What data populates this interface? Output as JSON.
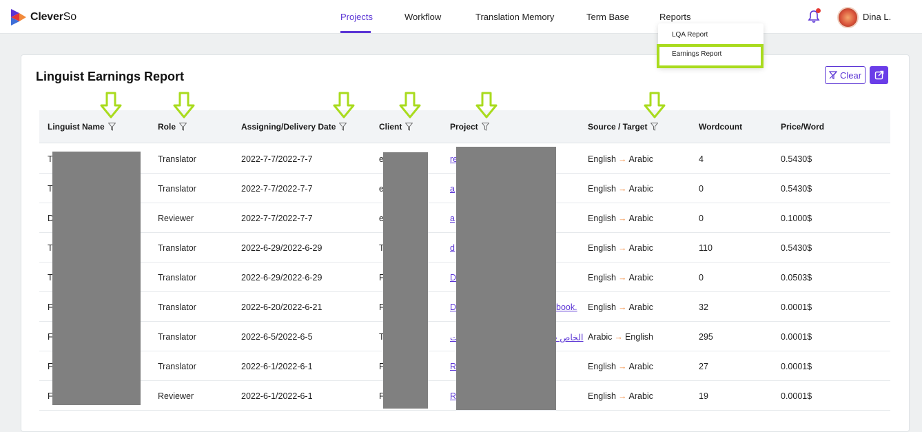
{
  "brand": {
    "name_bold": "Clever",
    "name_light": "So"
  },
  "nav": [
    {
      "label": "Projects",
      "active": true
    },
    {
      "label": "Workflow",
      "active": false
    },
    {
      "label": "Translation Memory",
      "active": false
    },
    {
      "label": "Term Base",
      "active": false
    },
    {
      "label": "Reports",
      "active": false
    }
  ],
  "reports_menu": [
    "LQA Report",
    "Earnings Report"
  ],
  "user": {
    "name": "Dina L."
  },
  "page": {
    "title": "Linguist Earnings Report",
    "clear_label": "Clear"
  },
  "table": {
    "headers": [
      "Linguist Name",
      "Role",
      "Assigning/Delivery Date",
      "Client",
      "Project",
      "Source / Target",
      "Wordcount",
      "Price/Word"
    ],
    "rows": [
      {
        "name": "T",
        "role": "Translator",
        "dates": "2022-7-7/2022-7-7",
        "client": "e",
        "project": "re",
        "project_tail": "",
        "source": "English",
        "target": "Arabic",
        "words": "4",
        "price": "0.5430$"
      },
      {
        "name": "T",
        "role": "Translator",
        "dates": "2022-7-7/2022-7-7",
        "client": "e",
        "project": "a",
        "project_tail": "",
        "source": "English",
        "target": "Arabic",
        "words": "0",
        "price": "0.5430$"
      },
      {
        "name": "D",
        "role": "Reviewer",
        "dates": "2022-7-7/2022-7-7",
        "client": "e",
        "project": "a",
        "project_tail": "",
        "source": "English",
        "target": "Arabic",
        "words": "0",
        "price": "0.1000$"
      },
      {
        "name": "T",
        "role": "Translator",
        "dates": "2022-6-29/2022-6-29",
        "client": "T",
        "project": "d",
        "project_tail": "",
        "source": "English",
        "target": "Arabic",
        "words": "110",
        "price": "0.5430$"
      },
      {
        "name": "T",
        "role": "Translator",
        "dates": "2022-6-29/2022-6-29",
        "client": "F",
        "project": "D",
        "project_tail": "",
        "source": "English",
        "target": "Arabic",
        "words": "0",
        "price": "0.0503$"
      },
      {
        "name": "F",
        "role": "Translator",
        "dates": "2022-6-20/2022-6-21",
        "client": "F",
        "project": "D",
        "project_tail": "book.",
        "source": "English",
        "target": "Arabic",
        "words": "32",
        "price": "0.0001$"
      },
      {
        "name": "F",
        "role": "Translator",
        "dates": "2022-6-5/2022-6-5",
        "client": "T",
        "project": "ت",
        "project_tail": "الخاص ب",
        "source": "Arabic",
        "target": "English",
        "words": "295",
        "price": "0.0001$"
      },
      {
        "name": "F",
        "role": "Translator",
        "dates": "2022-6-1/2022-6-1",
        "client": "F",
        "project": "R",
        "project_tail": "",
        "source": "English",
        "target": "Arabic",
        "words": "27",
        "price": "0.0001$"
      },
      {
        "name": "F",
        "role": "Reviewer",
        "dates": "2022-6-1/2022-6-1",
        "client": "F",
        "project": "R",
        "project_tail": "",
        "source": "English",
        "target": "Arabic",
        "words": "19",
        "price": "0.0001$"
      }
    ]
  },
  "colors": {
    "accent": "#5b35d5",
    "highlight": "#a9db1e",
    "arrow": "#f28a3b"
  }
}
